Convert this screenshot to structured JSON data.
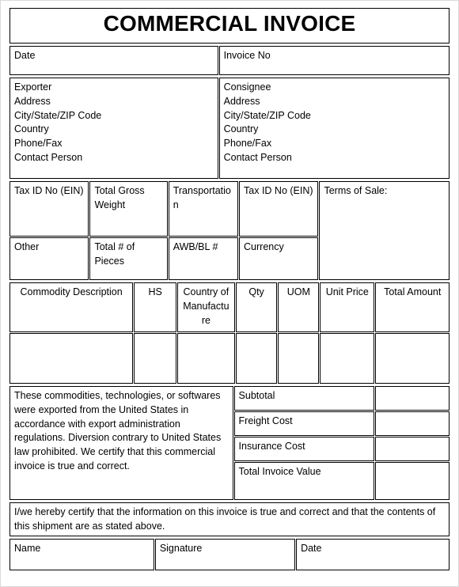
{
  "document": {
    "title": "COMMERCIAL INVOICE"
  },
  "header_row": {
    "date_label": "Date",
    "invoice_no_label": "Invoice No"
  },
  "parties": {
    "exporter": {
      "heading": "Exporter",
      "lines": [
        "Address",
        "City/State/ZIP Code",
        "Country",
        "Phone/Fax",
        "Contact Person"
      ]
    },
    "consignee": {
      "heading": "Consignee",
      "lines": [
        "Address",
        "City/State/ZIP Code",
        "Country",
        "Phone/Fax",
        "Contact Person"
      ]
    }
  },
  "shipment": {
    "row1": {
      "tax_id_exporter": "Tax ID No (EIN)",
      "total_gross_weight": "Total Gross Weight",
      "transportation": "Transportation",
      "tax_id_consignee": "Tax ID No (EIN)",
      "terms_of_sale": "Terms of Sale:"
    },
    "row2": {
      "other": "Other",
      "total_pieces": "Total # of Pieces",
      "awb_bl": "AWB/BL #",
      "currency": "Currency"
    }
  },
  "commodity_table": {
    "columns": [
      "Commodity Description",
      "HS",
      "Country of Manufacture",
      "Qty",
      "UOM",
      "Unit Price",
      "Total Amount"
    ],
    "rows": [
      [
        "",
        "",
        "",
        "",
        "",
        "",
        ""
      ]
    ]
  },
  "totals": {
    "legal_statement": "These commodities, technologies, or softwares were exported from the United States in accordance with export administration regulations. Diversion contrary to United States law prohibited. We certify that this commercial invoice is true and correct.",
    "lines": [
      {
        "label": "Subtotal",
        "value": ""
      },
      {
        "label": "Freight Cost",
        "value": ""
      },
      {
        "label": "Insurance Cost",
        "value": ""
      },
      {
        "label": "Total Invoice Value",
        "value": ""
      }
    ]
  },
  "certification": {
    "statement": "I/we hereby certify that the information on this invoice is true and correct and that the contents of this shipment are as stated above.",
    "name_label": "Name",
    "signature_label": "Signature",
    "date_label": "Date"
  }
}
